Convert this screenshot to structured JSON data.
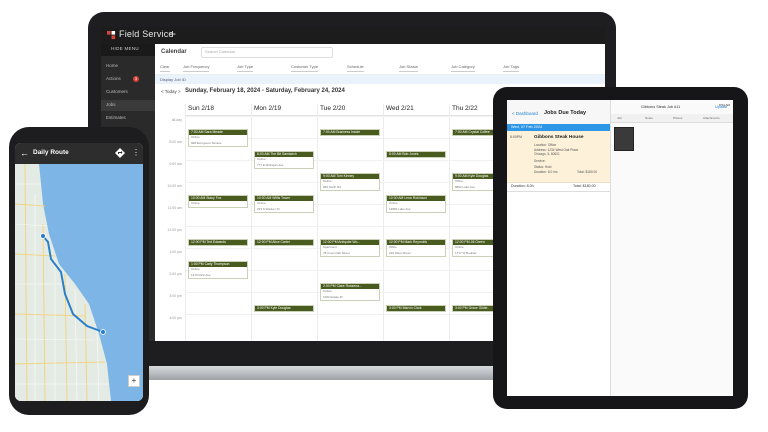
{
  "laptop": {
    "app_title": "Field Service",
    "plus": "+",
    "sidebar": {
      "hide_menu": "HIDE MENU",
      "items": [
        {
          "label": "Home"
        },
        {
          "label": "Actions",
          "badge": "3"
        },
        {
          "label": "Customers"
        },
        {
          "label": "Jobs"
        },
        {
          "label": "Estimates"
        }
      ]
    },
    "calendar": {
      "title": "Calendar",
      "search_placeholder": "Search Calendar",
      "filters": [
        "Clear",
        "Job Frequency",
        "Job Type",
        "Customer Type",
        "Schedule",
        "Job Status",
        "Job Category",
        "Job Tags"
      ],
      "info": "Display Job ID",
      "today": "< Today >",
      "week_range": "Sunday, February 18, 2024 - Saturday, February 24, 2024",
      "days": [
        "Sun 2/18",
        "Mon 2/19",
        "Tue 2/20",
        "Wed 2/21",
        "Thu 2/22"
      ],
      "times": [
        "all-day",
        "8:00 am",
        "9:00 am",
        "10:00 am",
        "11:00 am",
        "12:00 pm",
        "1:00 pm",
        "2:00 pm",
        "3:00 pm",
        "4:00 pm"
      ],
      "events": [
        {
          "day": 0,
          "time": "7:00 AM",
          "name": "Sara Meade",
          "sub": "Online",
          "sub2": "908 Evergreen Terrace"
        },
        {
          "day": 0,
          "time": "10:00 AM",
          "name": "Stacy Fox",
          "sub": "Online",
          "sub2": ""
        },
        {
          "day": 0,
          "time": "12:00 PM",
          "name": "Ted Edwards",
          "sub": "",
          "sub2": ""
        },
        {
          "day": 0,
          "time": "1:00 PM",
          "name": "Carly Thompson",
          "sub": "Online",
          "sub2": "1470 Park Ave"
        },
        {
          "day": 1,
          "time": "8:00 AM",
          "name": "The Bit Sandwich",
          "sub": "Online",
          "sub2": "777 E Michigan Ave"
        },
        {
          "day": 1,
          "time": "10:00 AM",
          "name": "Willis Tower",
          "sub": "Online",
          "sub2": "233 S Wacker Dr"
        },
        {
          "day": 1,
          "time": "12:00 PM",
          "name": "Alice Carter",
          "sub": "",
          "sub2": ""
        },
        {
          "day": 1,
          "time": "3:00 PM",
          "name": "Kyle Douglas",
          "sub": "",
          "sub2": ""
        },
        {
          "day": 2,
          "time": "7:00 AM",
          "name": "Business Inside",
          "sub": "",
          "sub2": ""
        },
        {
          "day": 2,
          "time": "9:00 AM",
          "name": "Tom Kinney",
          "sub": "Online",
          "sub2": "983 North Rd"
        },
        {
          "day": 2,
          "time": "12:00 PM",
          "name": "Antiquite Wo...",
          "sub": "Apartment",
          "sub2": "78 Court Oak Street"
        },
        {
          "day": 2,
          "time": "2:00 PM",
          "name": "Clare Rossena...",
          "sub": "Online",
          "sub2": "1002 Estate Dr"
        },
        {
          "day": 3,
          "time": "8:00 AM",
          "name": "Bob Jones",
          "sub": "",
          "sub2": ""
        },
        {
          "day": 3,
          "time": "10:00 AM",
          "name": "Lena Robinson",
          "sub": "Online",
          "sub2": "14860 Lake Ave"
        },
        {
          "day": 3,
          "time": "12:00 PM",
          "name": "Mark Reynolds",
          "sub": "Office",
          "sub2": "210 West Street"
        },
        {
          "day": 3,
          "time": "3:00 PM",
          "name": "Marvin Clark",
          "sub": "",
          "sub2": ""
        },
        {
          "day": 4,
          "time": "7:00 AM",
          "name": "Crystal Coffee",
          "sub": "",
          "sub2": ""
        },
        {
          "day": 4,
          "time": "9:00 AM",
          "name": "Kyle Douglas",
          "sub": "Office",
          "sub2": "8802 Lake Ave"
        },
        {
          "day": 4,
          "time": "12:00 PM",
          "name": "Jill Green",
          "sub": "Online",
          "sub2": "1777 W Boulder"
        },
        {
          "day": 4,
          "time": "3:00 PM",
          "name": "Grace Gildie...",
          "sub": "",
          "sub2": ""
        }
      ]
    }
  },
  "phone": {
    "title": "Daily Route",
    "back": "←",
    "more": "⋮",
    "zoom": "+",
    "colors": {
      "water": "#7db6e6",
      "land": "#e4ebe4",
      "route": "#2a7fc9"
    }
  },
  "tablet": {
    "back": "< Dashboard",
    "title": "Jobs Due Today",
    "date_bar": "Wed, 07 Feb 2024",
    "job": {
      "time": "8:00PM",
      "name": "Gibbons Steak House",
      "lines": [
        "Location: Office",
        "Address: 1234 West Oak Place",
        "Chicago, IL 60601",
        "Service:",
        "Status: Hold",
        "Duration: 8.0 hrs"
      ],
      "total": "Total: $180.00"
    },
    "footer_left": "Duration: 8.0h",
    "footer_right": "Total: $180.00",
    "right_title": "Gibbons Steak Job #11",
    "right_link": "Update",
    "status_time": "8:54 AM",
    "tabs": [
      "Job",
      "Notes",
      "Photos",
      "Attachments"
    ]
  }
}
